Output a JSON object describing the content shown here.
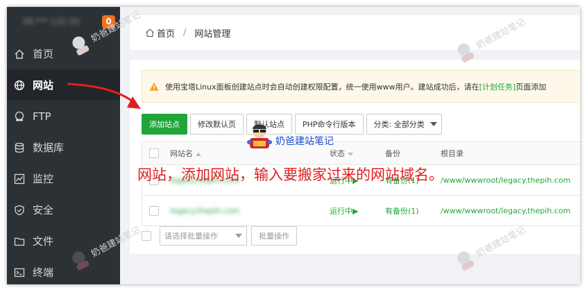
{
  "sidebar": {
    "server_name": "38.***.132.50",
    "badge": "0",
    "items": [
      {
        "label": "首页",
        "icon": "home-icon"
      },
      {
        "label": "网站",
        "icon": "globe-icon"
      },
      {
        "label": "FTP",
        "icon": "ftp-icon"
      },
      {
        "label": "数据库",
        "icon": "database-icon"
      },
      {
        "label": "监控",
        "icon": "monitor-icon"
      },
      {
        "label": "安全",
        "icon": "shield-icon"
      },
      {
        "label": "文件",
        "icon": "folder-icon"
      },
      {
        "label": "终端",
        "icon": "terminal-icon"
      }
    ]
  },
  "breadcrumb": {
    "home": "首页",
    "separator": "/",
    "current": "网站管理"
  },
  "alert": {
    "text": "使用宝塔Linux面板创建站点时会自动创建权限配置，统一使用www用户。建站成功后，请在",
    "link": "[计划任务]",
    "tail": "页面添加"
  },
  "toolbar": {
    "add_site": "添加站点",
    "edit_default_page": "修改默认页",
    "default_site": "默认站点",
    "php_cli": "PHP命令行版本",
    "category": "分类: 全部分类"
  },
  "table": {
    "headers": {
      "name": "网站名",
      "status": "状态",
      "backup": "备份",
      "root": "根目录"
    },
    "rows": [
      {
        "name": "legacy.thepih.com",
        "status": "运行中▶",
        "backup": "有备份(1)",
        "root": "/www/wwwroot/legacy.thepih.com"
      },
      {
        "name": "legacy.thepih.com",
        "status": "运行中▶",
        "backup": "有备份(1)",
        "root": "/www/wwwroot/legacy.thepih.com"
      }
    ]
  },
  "batch": {
    "placeholder": "请选择批量操作",
    "button": "批量操作"
  },
  "annotation": "网站，添加网站，输入要搬家过来的网站域名。",
  "watermark": "奶爸建站笔记",
  "colors": {
    "sidebar_bg": "#2c3135",
    "accent_green": "#20a53a",
    "badge_orange": "#f0701f",
    "annotation_red": "#e02020"
  }
}
